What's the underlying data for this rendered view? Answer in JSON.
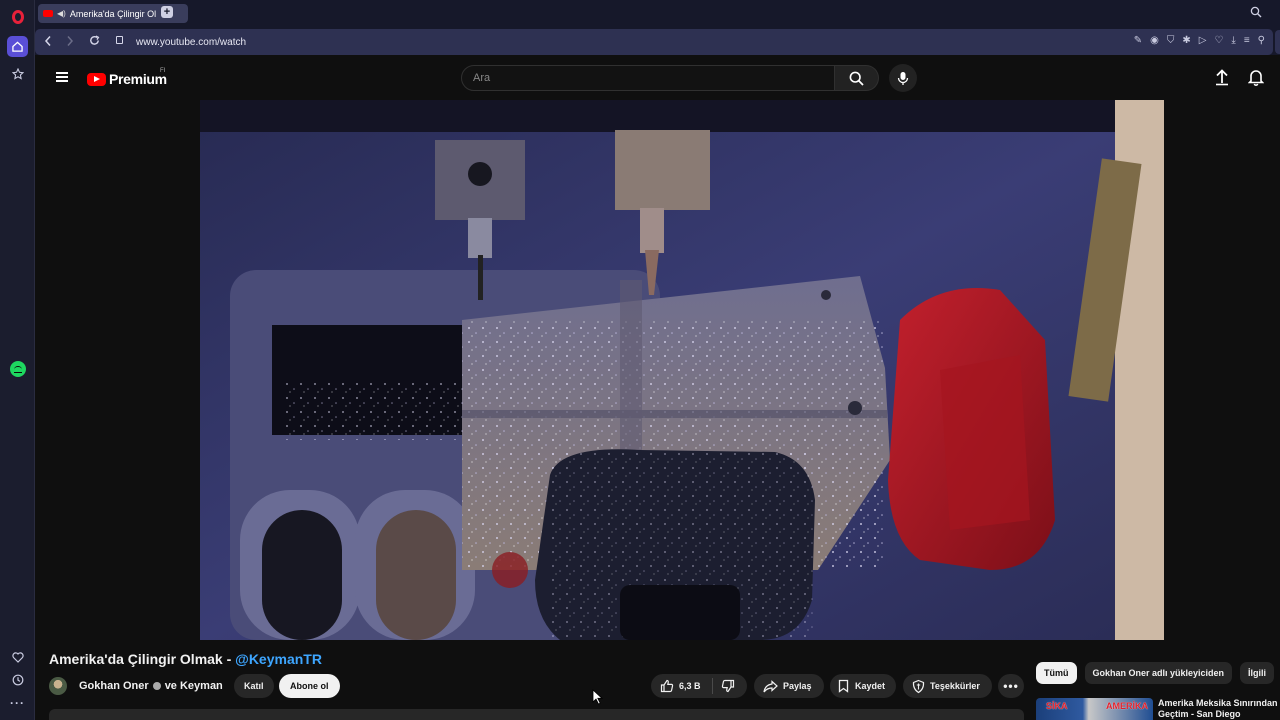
{
  "browser": {
    "tab_title": "Amerika'da Çilingir Ol",
    "url": "www.youtube.com/watch"
  },
  "youtube": {
    "logo_text": "Premium",
    "country_code": "FI",
    "search_placeholder": "Ara"
  },
  "video": {
    "title_prefix": "Amerika'da Çilingir Olmak - ",
    "title_handle": "@KeymanTR",
    "channel": "Gokhan Oner",
    "channel_suffix": "ve Keyman",
    "join_label": "Katıl",
    "subscribe_label": "Abone ol",
    "like_count": "6,3 B",
    "share_label": "Paylaş",
    "save_label": "Kaydet",
    "thanks_label": "Teşekkürler"
  },
  "chips": [
    {
      "label": "Tümü"
    },
    {
      "label": "Gokhan Oner adlı yükleyiciden"
    },
    {
      "label": "İlgili"
    }
  ],
  "recommendation": {
    "title": "Amerika Meksika Sınırından Geçtim - San Diego California",
    "thumb_text_1": "SİKA",
    "thumb_text_2": "AMERİKA"
  },
  "colors": {
    "accent": "#ff0000",
    "link": "#3ea6ff",
    "opera_sidebar": "#1b1d2e",
    "address_bar": "#2e3152"
  }
}
